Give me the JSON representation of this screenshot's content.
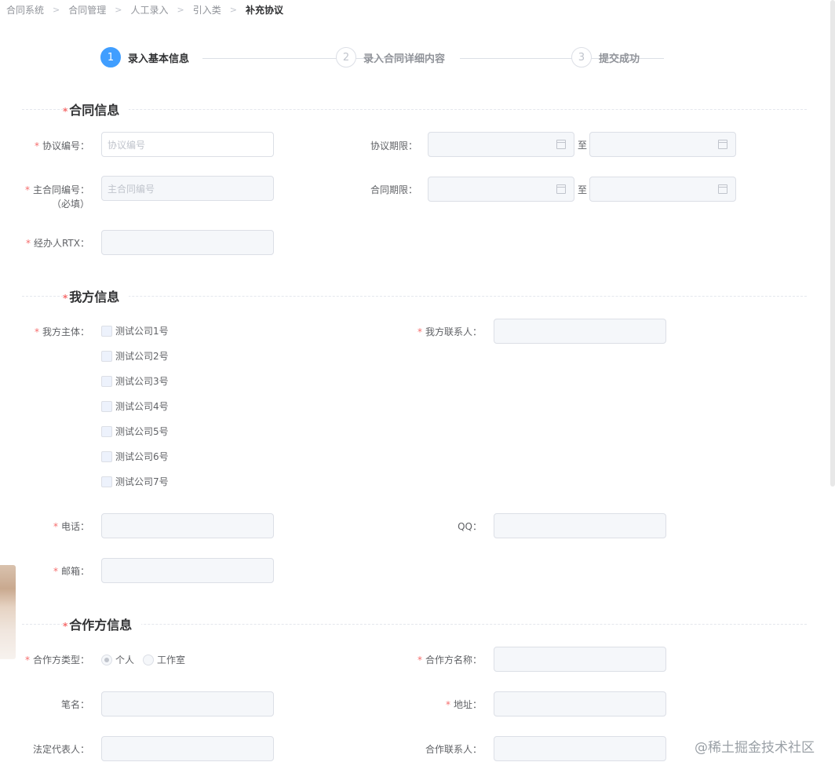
{
  "breadcrumb": {
    "items": [
      "合同系统",
      "合同管理",
      "人工录入",
      "引入类",
      "补充协议"
    ],
    "separator": ">"
  },
  "steps": [
    {
      "number": "1",
      "title": "录入基本信息",
      "active": true
    },
    {
      "number": "2",
      "title": "录入合同详细内容",
      "active": false
    },
    {
      "number": "3",
      "title": "提交成功",
      "active": false
    }
  ],
  "sections": {
    "contract": "合同信息",
    "ours": "我方信息",
    "partner": "合作方信息",
    "required_mark": "*"
  },
  "contract_info": {
    "agreement_no_label": "协议编号：",
    "agreement_no_placeholder": "协议编号",
    "main_contract_no_label": "主合同编号：",
    "main_contract_no_sub": "（必填）",
    "main_contract_no_placeholder": "主合同编号",
    "handler_rtx_label": "经办人RTX：",
    "agreement_period_label": "协议期限：",
    "contract_period_label": "合同期限：",
    "to_text": "至"
  },
  "our_info": {
    "subject_label": "我方主体：",
    "companies": [
      "测试公司1号",
      "测试公司2号",
      "测试公司3号",
      "测试公司4号",
      "测试公司5号",
      "测试公司6号",
      "测试公司7号"
    ],
    "contact_label": "我方联系人：",
    "phone_label": "电话：",
    "qq_label": "QQ：",
    "email_label": "邮箱："
  },
  "partner_info": {
    "type_label": "合作方类型：",
    "type_options": [
      "个人",
      "工作室"
    ],
    "type_selected": "个人",
    "name_label": "合作方名称：",
    "pen_name_label": "笔名：",
    "address_label": "地址：",
    "legal_rep_label": "法定代表人：",
    "contact_label": "合作联系人："
  },
  "watermark": "@稀土掘金技术社区",
  "colors": {
    "primary": "#409eff",
    "required": "#f56c6c",
    "disabled_bg": "#f5f7fa",
    "border": "#dcdfe6"
  }
}
